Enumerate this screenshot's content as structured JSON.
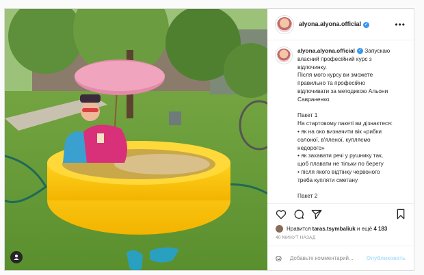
{
  "post": {
    "username": "alyona.alyona.official",
    "more_icon": "more-horizontal-icon",
    "caption": {
      "username": "alyona.alyona.official",
      "lines": [
        "Запускаю",
        "власний професійний курс з",
        "відпочинку.",
        "Після мого курсу ви зможете",
        "правильно та професійно",
        "відпочивати за методикою Альони",
        "Савраненко",
        "",
        "Пакет 1",
        "На стартовому пакеті ви дізнаєтеся:",
        "• як на око визначити вік «рибки",
        "солоної, в'яленої, купляємо",
        "недорого»",
        "• як захавати речі у рушнику так,",
        "щоб плавати не тільки по берегу",
        "• після якого відтінку червоного",
        "треба купляти сметану",
        "",
        "Пакет 2"
      ]
    },
    "likes": {
      "prefix": "Нравится ",
      "user": "taras.tsymbaliuk",
      "middle": " и ещё ",
      "count": "4 183"
    },
    "time_ago": "40 МИНУТ НАЗАД",
    "comment": {
      "placeholder": "Добавьте комментарий...",
      "post_label": "Опубликовать"
    }
  }
}
